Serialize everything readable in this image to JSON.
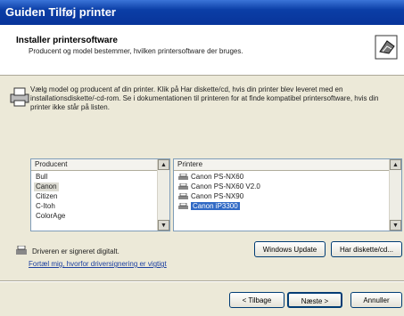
{
  "window": {
    "title": "Guiden Tilføj printer"
  },
  "header": {
    "title": "Installer printersoftware",
    "subtitle": "Producent og model bestemmer, hvilken printersoftware der bruges."
  },
  "intro": {
    "text": "Vælg model og producent af din printer. Klik på Har diskette/cd, hvis din printer blev leveret med en installationsdiskette/-cd-rom. Se i dokumentationen til printeren for at finde kompatibel printersoftware, hvis din printer ikke står på listen."
  },
  "manufacturers": {
    "header": "Producent",
    "items": [
      "Bull",
      "Canon",
      "Citizen",
      "C-Itoh",
      "ColorAge"
    ],
    "selected": "Canon"
  },
  "printers": {
    "header": "Printere",
    "items": [
      "Canon PS-NX60",
      "Canon PS-NX60 V2.0",
      "Canon PS-NX90",
      "Canon iP3300"
    ],
    "selected": "Canon iP3300"
  },
  "signature": {
    "text": "Driveren er signeret digitalt.",
    "link": "Fortæl mig, hvorfor driversignering er vigtigt"
  },
  "buttons": {
    "windows_update": "Windows Update",
    "have_disk": "Har diskette/cd...",
    "back": "< Tilbage",
    "next": "Næste >",
    "cancel": "Annuller"
  },
  "colors": {
    "titlebar": "#0b3ea6",
    "selection": "#316ac5",
    "dialog": "#ece9d8"
  }
}
